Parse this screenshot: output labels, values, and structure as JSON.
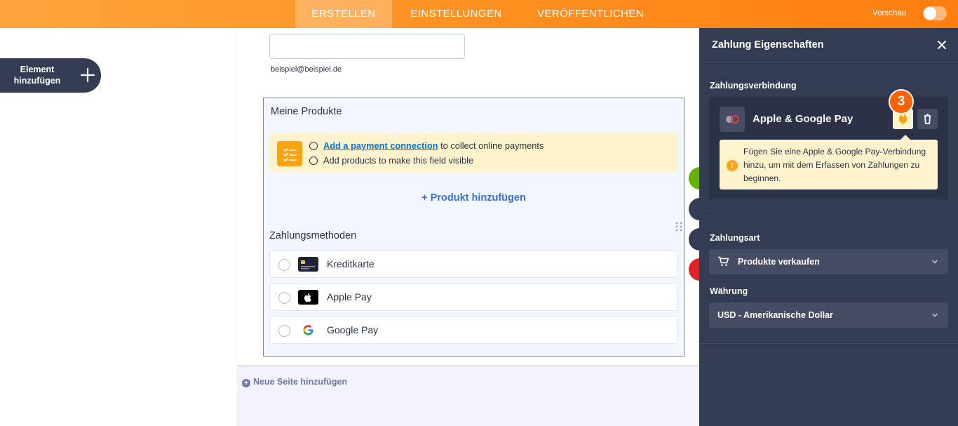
{
  "topbar": {
    "tabs": [
      {
        "label": "ERSTELLEN",
        "active": true
      },
      {
        "label": "EINSTELLUNGEN",
        "active": false
      },
      {
        "label": "VERÖFFENTLICHEN",
        "active": false
      }
    ],
    "preview_label": "Vorschau",
    "preview_on": false
  },
  "sidebar": {
    "add_element_label": "Element hinzufügen"
  },
  "form": {
    "email_hint": "beispiel@beispiel.de",
    "products_title": "Meine Produkte",
    "notice": {
      "link_text": "Add a payment connection",
      "line1_rest": " to collect online payments",
      "line2": "Add products to make this field visible"
    },
    "add_product_label": "+ Produkt hinzufügen",
    "payment_methods_title": "Zahlungsmethoden",
    "payment_methods": [
      {
        "label": "Kreditkarte",
        "icon": "credit-card-icon"
      },
      {
        "label": "Apple Pay",
        "icon": "apple-icon"
      },
      {
        "label": "Google Pay",
        "icon": "google-icon"
      }
    ],
    "new_page_label": "Neue Seite hinzufügen"
  },
  "panel": {
    "title": "Zahlung Eigenschaften",
    "connection_section_label": "Zahlungsverbindung",
    "connection_name": "Apple & Google Pay",
    "step_badge": "3",
    "warning_text": "Fügen Sie eine Apple & Google Pay-Verbindung hinzu, um mit dem Erfassen von Zahlungen zu beginnen.",
    "payment_type_label": "Zahlungsart",
    "payment_type_value": "Produkte verkaufen",
    "currency_label": "Währung",
    "currency_value": "USD - Amerikanische Dollar"
  },
  "colors": {
    "topbar_orange": "#ff8f1f",
    "panel_bg": "#343c54",
    "accent_blue": "#3b70d6",
    "warning_yellow": "#fff3cd",
    "step_badge": "#ff6100"
  }
}
